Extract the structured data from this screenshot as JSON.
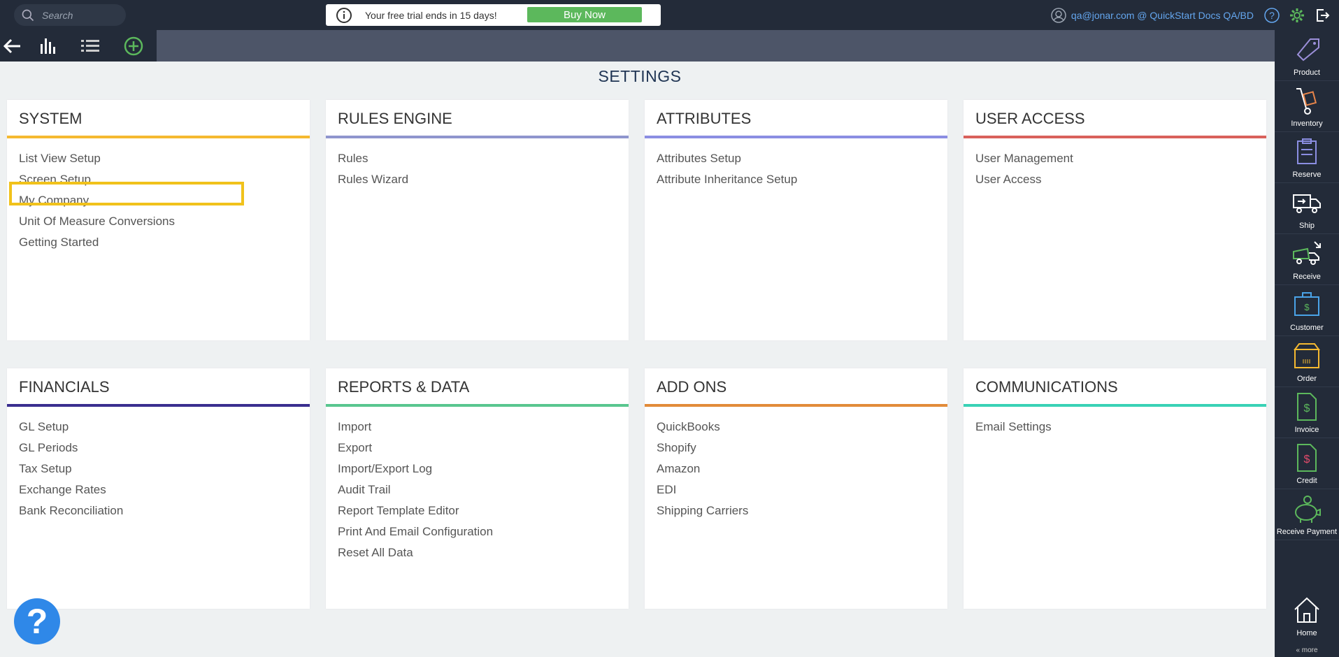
{
  "search": {
    "placeholder": "Search"
  },
  "trial": {
    "text": "Your free trial ends in 15 days!",
    "buy_label": "Buy Now"
  },
  "user": {
    "account": "qa@jonar.com @ QuickStart Docs QA/BD"
  },
  "page": {
    "title": "SETTINGS"
  },
  "cards": [
    {
      "title": "SYSTEM",
      "color": "#f5b930",
      "links": [
        "List View Setup",
        "Screen Setup",
        "My Company",
        "Unit Of Measure Conversions",
        "Getting Started"
      ]
    },
    {
      "title": "RULES ENGINE",
      "color": "#8f95cd",
      "links": [
        "Rules",
        "Rules Wizard"
      ]
    },
    {
      "title": "ATTRIBUTES",
      "color": "#8b8ee2",
      "links": [
        "Attributes Setup",
        "Attribute Inheritance Setup"
      ]
    },
    {
      "title": "USER ACCESS",
      "color": "#d9615b",
      "links": [
        "User Management",
        "User Access"
      ]
    },
    {
      "title": "FINANCIALS",
      "color": "#3a2e8f",
      "links": [
        "GL Setup",
        "GL Periods",
        "Tax Setup",
        "Exchange Rates",
        "Bank Reconciliation"
      ]
    },
    {
      "title": "REPORTS & DATA",
      "color": "#59c68f",
      "links": [
        "Import",
        "Export",
        "Import/Export Log",
        "Audit Trail",
        "Report Template Editor",
        "Print And Email Configuration",
        "Reset All Data"
      ]
    },
    {
      "title": "ADD ONS",
      "color": "#e28b39",
      "links": [
        "QuickBooks",
        "Shopify",
        "Amazon",
        "EDI",
        "Shipping Carriers"
      ]
    },
    {
      "title": "COMMUNICATIONS",
      "color": "#39d2b6",
      "links": [
        "Email Settings"
      ]
    }
  ],
  "sidebar": {
    "items": [
      {
        "label": "Product",
        "icon": "tag-icon"
      },
      {
        "label": "Inventory",
        "icon": "hand-truck-icon"
      },
      {
        "label": "Reserve",
        "icon": "clipboard-icon"
      },
      {
        "label": "Ship",
        "icon": "ship-truck-icon"
      },
      {
        "label": "Receive",
        "icon": "receive-truck-icon"
      },
      {
        "label": "Customer",
        "icon": "customer-briefcase-icon"
      },
      {
        "label": "Order",
        "icon": "order-box-icon"
      },
      {
        "label": "Invoice",
        "icon": "invoice-icon"
      },
      {
        "label": "Credit",
        "icon": "credit-icon"
      },
      {
        "label": "Receive Payment",
        "icon": "piggy-bank-icon"
      }
    ],
    "home_label": "Home",
    "more_label": "« more"
  },
  "help": {
    "label": "?"
  }
}
